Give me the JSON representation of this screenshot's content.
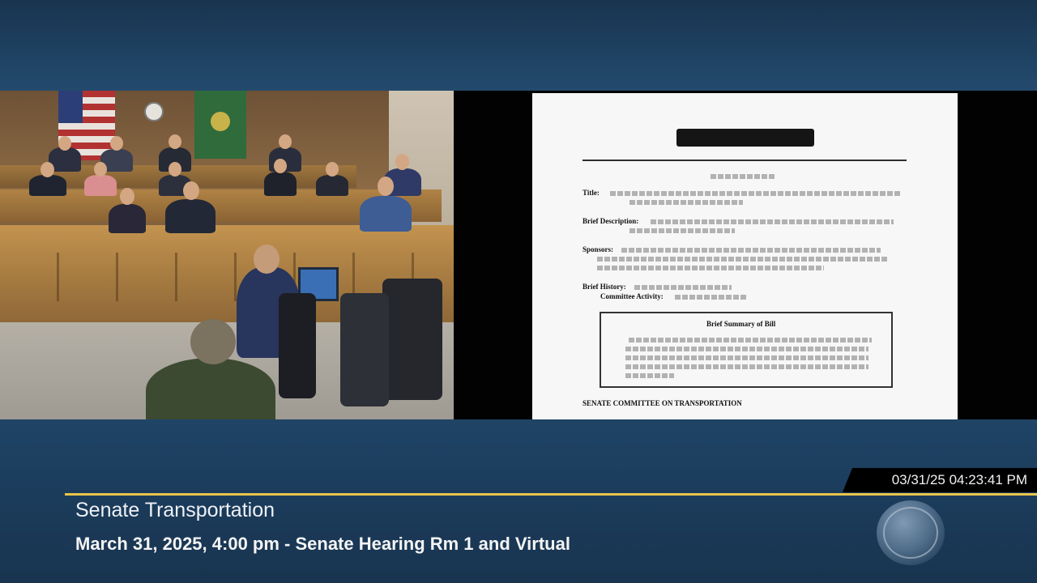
{
  "stream": {
    "committee_title": "Senate Transportation",
    "session_line": "March 31, 2025, 4:00 pm - Senate Hearing Rm 1 and Virtual",
    "timestamp": "03/31/25 04:23:41 PM"
  },
  "document": {
    "labels": {
      "title": "Title:",
      "brief_description": "Brief Description:",
      "sponsors": "Sponsors:",
      "brief_history": "Brief History:",
      "committee_activity": "Committee Activity:",
      "brief_summary": "Brief Summary of Bill",
      "committee_footer": "SENATE COMMITTEE ON TRANSPORTATION"
    }
  },
  "icons": {
    "logo": "tvw-logo-icon",
    "flag_us": "us-flag-icon",
    "flag_state": "state-flag-icon"
  },
  "colors": {
    "band": "#1f4466",
    "accent_rule": "#e8c44a",
    "timestamp_bg": "#000000"
  }
}
